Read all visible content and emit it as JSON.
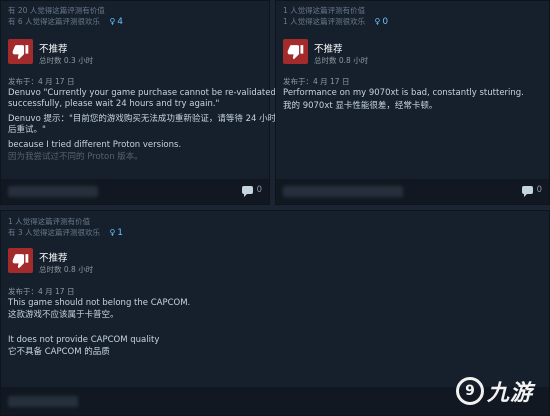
{
  "reviews": [
    {
      "helpful": "有 20 人觉得这篇评测有价值",
      "funny": "有 6 人觉得这篇评测很欢乐",
      "award_count": "4",
      "verdict": "不推荐",
      "hours": "总时数 0.3 小时",
      "posted": "发布于：4 月 17 日",
      "lines": [
        "Denuvo \"Currently your game purchase cannot be re-validated",
        "successfully, please wait 24 hours and try again.\"",
        "Denuvo 提示：\"目前您的游戏购买无法成功重新验证，请等待 24 小时",
        "后重试。\"",
        "because I tried different Proton versions.",
        "因为我尝试过不同的 Proton 版本。"
      ],
      "comment_count": "0"
    },
    {
      "helpful": "1 人觉得这篇评测有价值",
      "funny": "1 人觉得这篇评测很欢乐",
      "award_count": "0",
      "verdict": "不推荐",
      "hours": "总时数 0.8 小时",
      "posted": "发布于：4 月 17 日",
      "lines": [
        "Performance on my 9070xt is bad, constantly stuttering.",
        "我的 9070xt 显卡性能很差，经常卡顿。"
      ],
      "comment_count": "0"
    },
    {
      "helpful": "1 人觉得这篇评测有价值",
      "funny": "有 3 人觉得这篇评测很欢乐",
      "award_count": "1",
      "verdict": "不推荐",
      "hours": "总时数 0.8 小时",
      "posted": "发布于：4 月 17 日",
      "lines": [
        "This game should not belong the CAPCOM.",
        "这款游戏不应该属于卡普空。",
        "",
        "It does not provide CAPCOM quality",
        "它不具备 CAPCOM 的品质"
      ],
      "comment_count": "0"
    }
  ],
  "watermark": {
    "icon_glyph": "9",
    "text": "九游"
  },
  "colors": {
    "background": "#1b2433",
    "card": "#16202d",
    "thumb_down": "#a32b2b",
    "award_blue": "#66c0f4"
  },
  "icons": {
    "thumb": "thumbs-down-icon",
    "award": "award-medal-icon",
    "comment": "comment-bubble-icon"
  }
}
